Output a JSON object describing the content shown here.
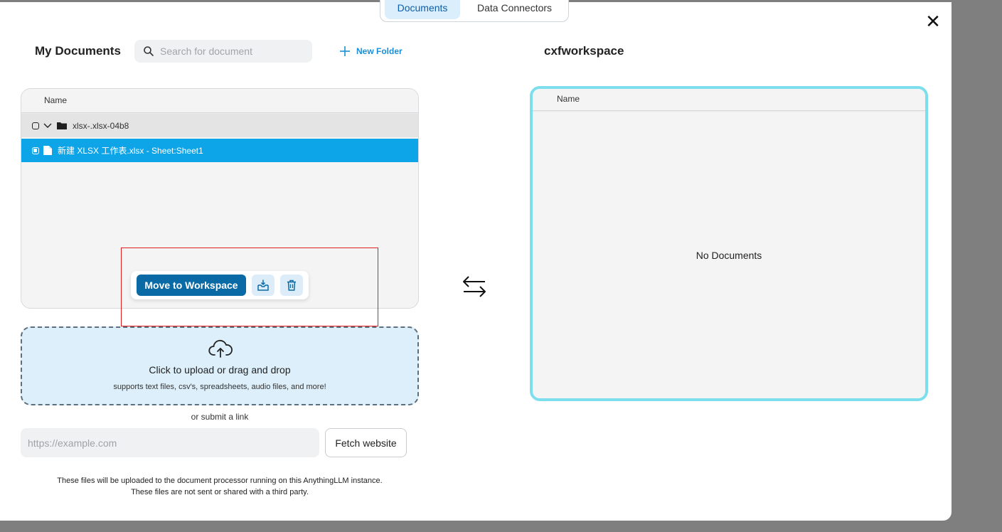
{
  "tabs": [
    {
      "label": "Documents",
      "active": true
    },
    {
      "label": "Data Connectors",
      "active": false
    }
  ],
  "left": {
    "title": "My Documents",
    "search_placeholder": "Search for document",
    "new_folder_label": "New Folder",
    "column_name": "Name",
    "rows": [
      {
        "type": "folder",
        "label": "xlsx-.xlsx-04b8",
        "expanded": true,
        "selected": false
      },
      {
        "type": "file",
        "label": "新建 XLSX 工作表.xlsx - Sheet:Sheet1",
        "selected": true
      }
    ],
    "toolbar": {
      "move_label": "Move to Workspace",
      "icons": [
        "move-to-folder-icon",
        "trash-icon"
      ]
    }
  },
  "upload": {
    "title": "Click to upload or drag and drop",
    "subtitle": "supports text files, csv's, spreadsheets, audio files, and more!",
    "or_submit": "or submit a link",
    "link_placeholder": "https://example.com",
    "fetch_label": "Fetch website",
    "note_line1": "These files will be uploaded to the document processor running on this AnythingLLM instance.",
    "note_line2": "These files are not sent or shared with a third party."
  },
  "right": {
    "title": "cxfworkspace",
    "column_name": "Name",
    "empty_text": "No Documents"
  },
  "colors": {
    "accent": "#0ea4e8",
    "move_button": "#0a6aa6",
    "workspace_border": "#7ddfed",
    "upload_bg": "#dceffb",
    "highlight_box": "#e11d1d"
  }
}
